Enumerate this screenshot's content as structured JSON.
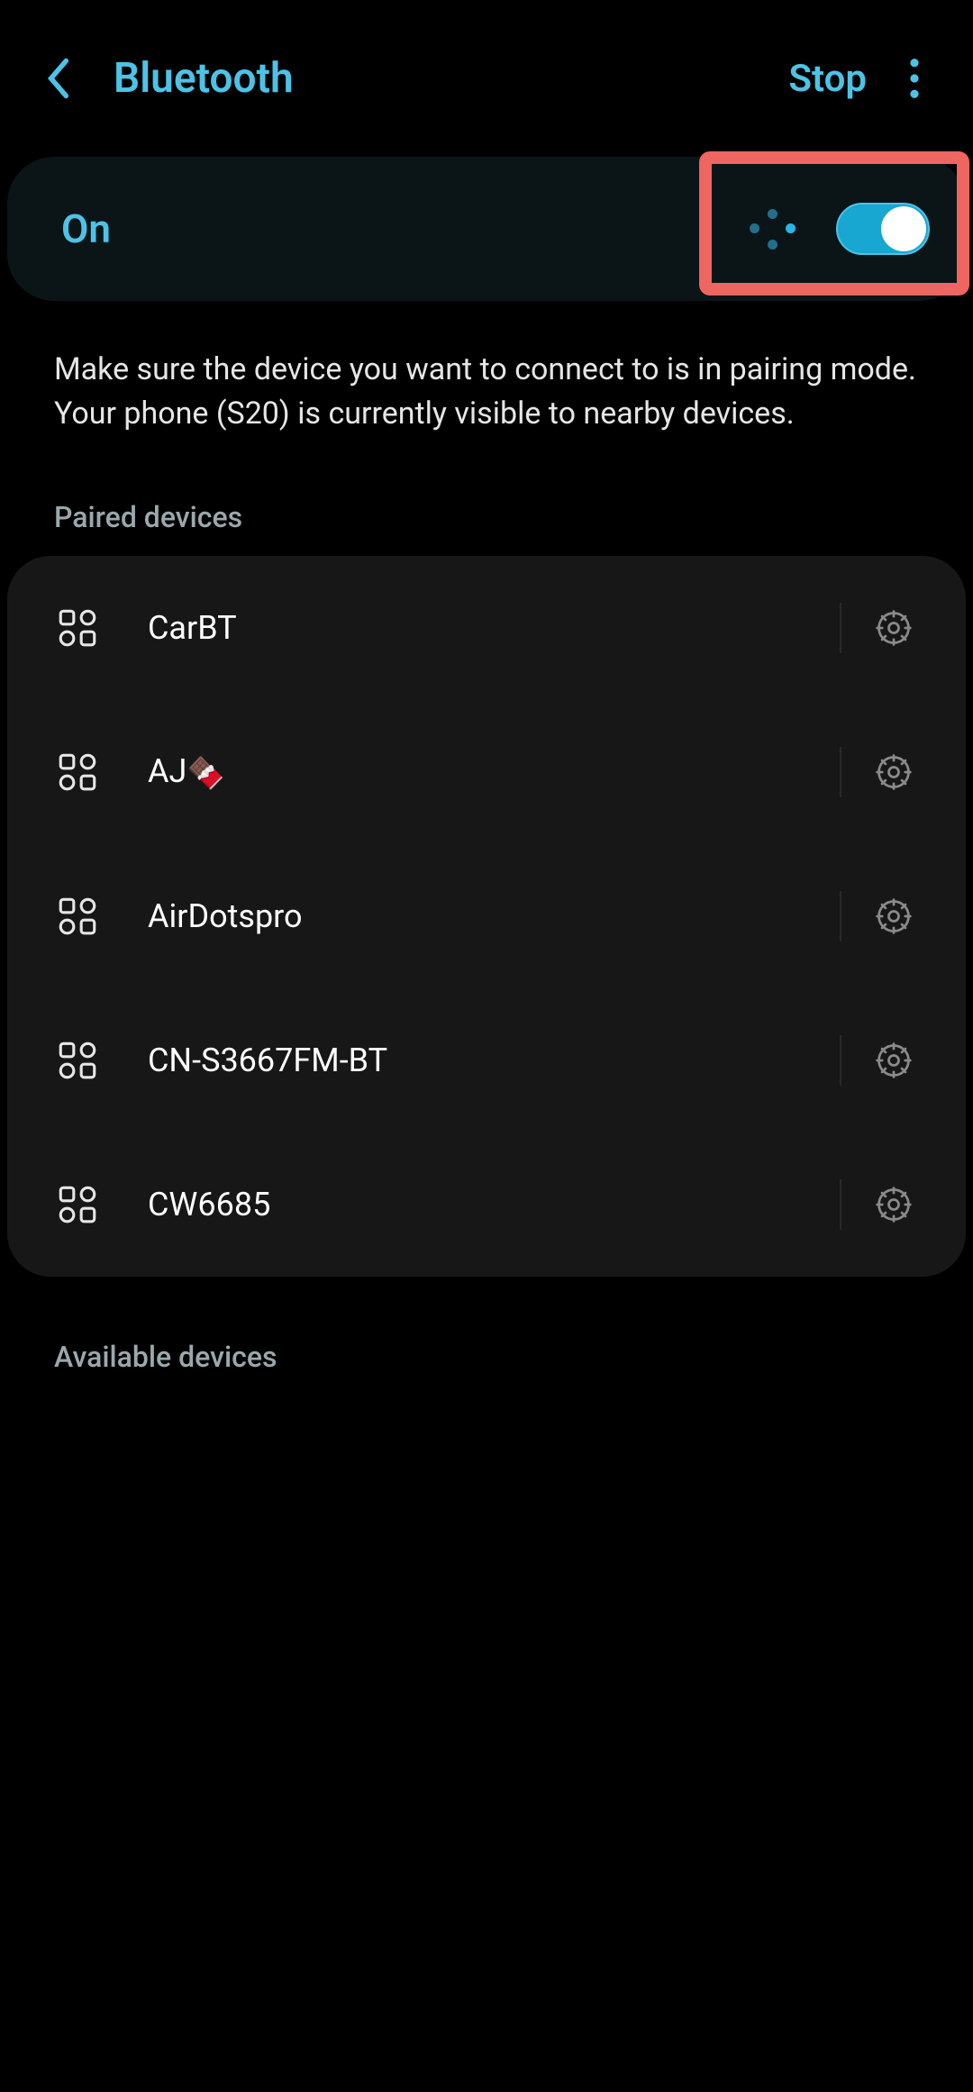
{
  "header": {
    "title": "Bluetooth",
    "stop_label": "Stop"
  },
  "status": {
    "label": "On",
    "toggled": true
  },
  "info_text": "Make sure the device you want to connect to is in pairing mode. Your phone (S20) is currently visible to nearby devices.",
  "sections": {
    "paired": "Paired devices",
    "available": "Available devices"
  },
  "paired_devices": [
    {
      "name": "CarBT",
      "emoji": ""
    },
    {
      "name": "AJ",
      "emoji": "🍫"
    },
    {
      "name": "AirDotspro",
      "emoji": ""
    },
    {
      "name": "CN-S3667FM-BT",
      "emoji": ""
    },
    {
      "name": "CW6685",
      "emoji": ""
    }
  ]
}
